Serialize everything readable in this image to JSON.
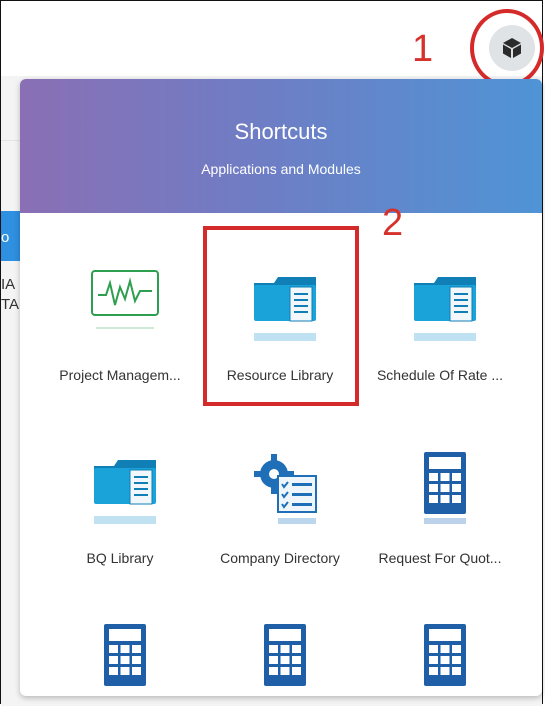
{
  "annotations": {
    "step1": "1",
    "step2": "2"
  },
  "background": {
    "tab_fragment": "o",
    "frag1": "IA",
    "frag2": "TA"
  },
  "panel": {
    "title": "Shortcuts",
    "subtitle": "Applications and Modules",
    "tiles": [
      {
        "label": "Project Managem...",
        "icon": "pulse-chart-icon"
      },
      {
        "label": "Resource Library",
        "icon": "folder-document-icon"
      },
      {
        "label": "Schedule Of Rate ...",
        "icon": "folder-document-icon"
      },
      {
        "label": "BQ Library",
        "icon": "folder-document-icon"
      },
      {
        "label": "Company Directory",
        "icon": "gear-checklist-icon"
      },
      {
        "label": "Request For Quot...",
        "icon": "calculator-icon"
      },
      {
        "label": "",
        "icon": "calculator-icon"
      },
      {
        "label": "",
        "icon": "calculator-icon"
      },
      {
        "label": "",
        "icon": "calculator-icon"
      }
    ]
  },
  "colors": {
    "accent_red": "#d52a2a",
    "header_start": "#8a6fb5",
    "header_end": "#4f94d6",
    "icon_blue": "#1aa3d9",
    "calc_blue": "#1f5fa8",
    "pulse_green": "#2e9e4f"
  }
}
